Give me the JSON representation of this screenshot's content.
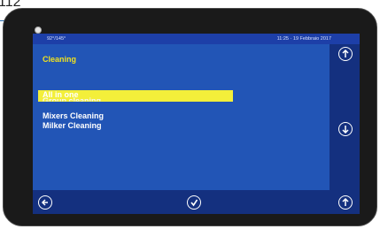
{
  "callout": {
    "number": "112"
  },
  "status": {
    "left": "92°/145°",
    "right": "11:25 · 19 Febbraio 2017"
  },
  "screen": {
    "title": "Cleaning",
    "menu": [
      {
        "label": "All in one",
        "selected": true
      },
      {
        "label": "Mixers Cleaning",
        "selected": false
      },
      {
        "label": "Milker Cleaning",
        "selected": false
      }
    ],
    "obscured_item": "Group cleaning"
  },
  "icons": {
    "right_top": "up-arrow-icon",
    "right_middle": "down-arrow-icon",
    "bottom_left": "back-arrow-icon",
    "bottom_center": "confirm-check-icon",
    "bottom_right": "up-arrow-icon"
  },
  "colors": {
    "screen_bg": "#1d3fa8",
    "highlight": "#f3ef3a",
    "title": "#f1e21d"
  }
}
